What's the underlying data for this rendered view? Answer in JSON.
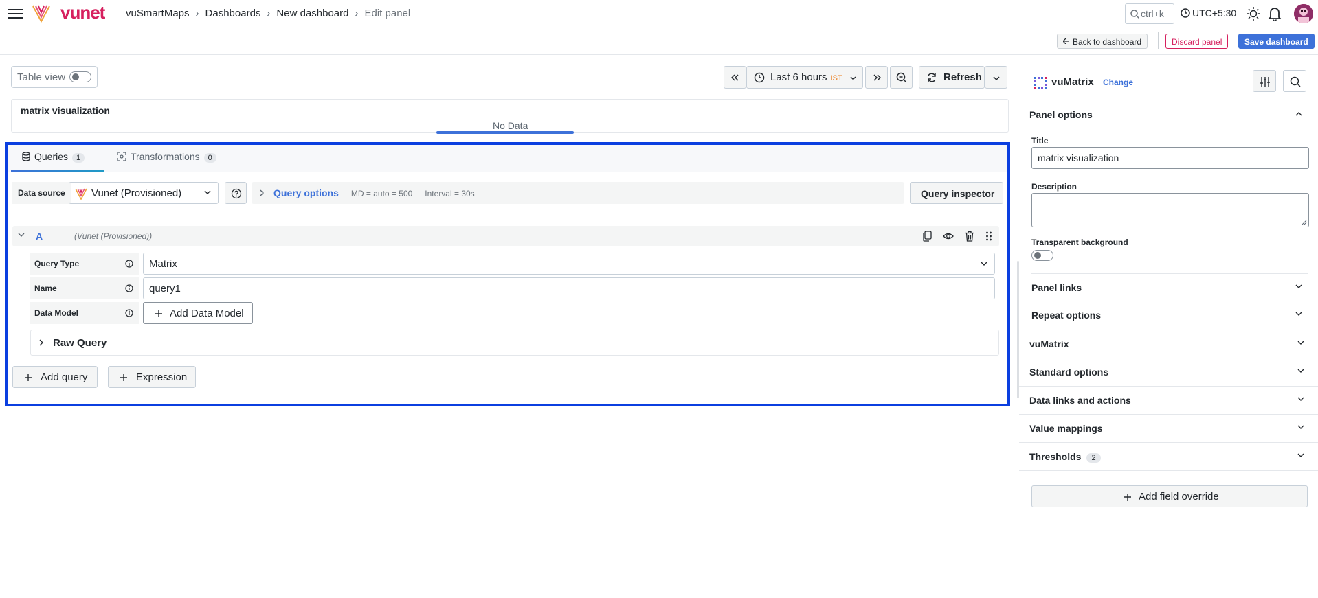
{
  "topbar": {
    "brand": "vunet",
    "breadcrumbs": [
      "vuSmartMaps",
      "Dashboards",
      "New dashboard",
      "Edit panel"
    ],
    "search_placeholder": "ctrl+k",
    "timezone": "UTC+5:30"
  },
  "subbar": {
    "back_label": "Back to dashboard",
    "discard_label": "Discard panel",
    "save_label": "Save dashboard"
  },
  "editor": {
    "table_view_label": "Table view",
    "time_range": "Last 6 hours",
    "time_zone_badge": "IST",
    "refresh_label": "Refresh",
    "panel_title": "matrix visualization",
    "no_data": "No Data"
  },
  "query_editor": {
    "tabs": [
      {
        "label": "Queries",
        "count": "1"
      },
      {
        "label": "Transformations",
        "count": "0"
      }
    ],
    "data_source_label": "Data source",
    "data_source_value": "Vunet (Provisioned)",
    "query_options_label": "Query options",
    "query_options_md": "MD = auto = 500",
    "query_options_interval": "Interval = 30s",
    "query_inspector_label": "Query inspector",
    "query": {
      "letter": "A",
      "datasource": "(Vunet (Provisioned))",
      "fields": {
        "type_label": "Query Type",
        "type_value": "Matrix",
        "name_label": "Name",
        "name_value": "query1",
        "data_model_label": "Data Model",
        "add_data_model_label": "Add Data Model"
      },
      "raw_query_label": "Raw Query"
    },
    "add_query_label": "Add query",
    "expression_label": "Expression"
  },
  "options_pane": {
    "viz_name": "vuMatrix",
    "change_label": "Change",
    "panel_options_label": "Panel options",
    "title_label": "Title",
    "title_value": "matrix visualization",
    "description_label": "Description",
    "transparent_label": "Transparent background",
    "panel_links_label": "Panel links",
    "repeat_options_label": "Repeat options",
    "sections": [
      "vuMatrix",
      "Standard options",
      "Data links and actions",
      "Value mappings",
      "Thresholds"
    ],
    "thresholds_count": "2",
    "add_override_label": "Add field override"
  },
  "colors": {
    "brand": "#d6205e",
    "accent": "#3d71d9",
    "highlight_border": "#0b3fe0",
    "ist_badge": "#ec7b17"
  },
  "icons": [
    "menu-icon",
    "vunet-logo-icon",
    "search-icon",
    "clock-icon",
    "sun-icon",
    "bell-icon",
    "database-icon",
    "transform-icon",
    "help-icon",
    "copy-icon",
    "eye-icon",
    "trash-icon",
    "drag-icon",
    "info-icon",
    "plus-icon",
    "chevron-down-icon",
    "chevron-right-icon",
    "zoom-out-icon",
    "refresh-icon",
    "options-icon",
    "matrix-icon"
  ]
}
